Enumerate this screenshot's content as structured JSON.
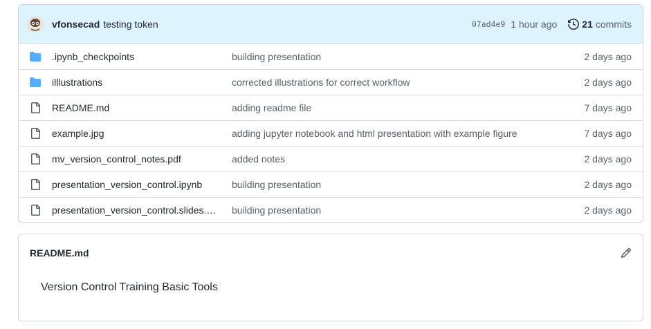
{
  "latest_commit": {
    "author": "vfonsecad",
    "message": "testing token",
    "sha": "07ad4e9",
    "time": "1 hour ago",
    "commit_count": "21",
    "commits_label": "commits"
  },
  "files": [
    {
      "type": "folder",
      "name": ".ipynb_checkpoints",
      "message": "building presentation",
      "age": "2 days ago"
    },
    {
      "type": "folder",
      "name": "illlustrations",
      "message": "corrected illustrations for correct workflow",
      "age": "2 days ago"
    },
    {
      "type": "file",
      "name": "README.md",
      "message": "adding readme file",
      "age": "7 days ago"
    },
    {
      "type": "file",
      "name": "example.jpg",
      "message": "adding jupyter notebook and html presentation with example figure",
      "age": "7 days ago"
    },
    {
      "type": "file",
      "name": "mv_version_control_notes.pdf",
      "message": "added notes",
      "age": "2 days ago"
    },
    {
      "type": "file",
      "name": "presentation_version_control.ipynb",
      "message": "building presentation",
      "age": "2 days ago"
    },
    {
      "type": "file",
      "name": "presentation_version_control.slides.html",
      "message": "building presentation",
      "age": "2 days ago"
    }
  ],
  "readme": {
    "title": "README.md",
    "content": "Version Control Training Basic Tools"
  },
  "colors": {
    "header_bg": "#ddf4ff",
    "folder_icon": "#54aeff",
    "border": "#d0d7de",
    "muted_text": "#57606a"
  },
  "icons": {
    "folder": "folder-icon",
    "file": "file-icon",
    "history": "history-icon",
    "edit": "pencil-icon"
  }
}
